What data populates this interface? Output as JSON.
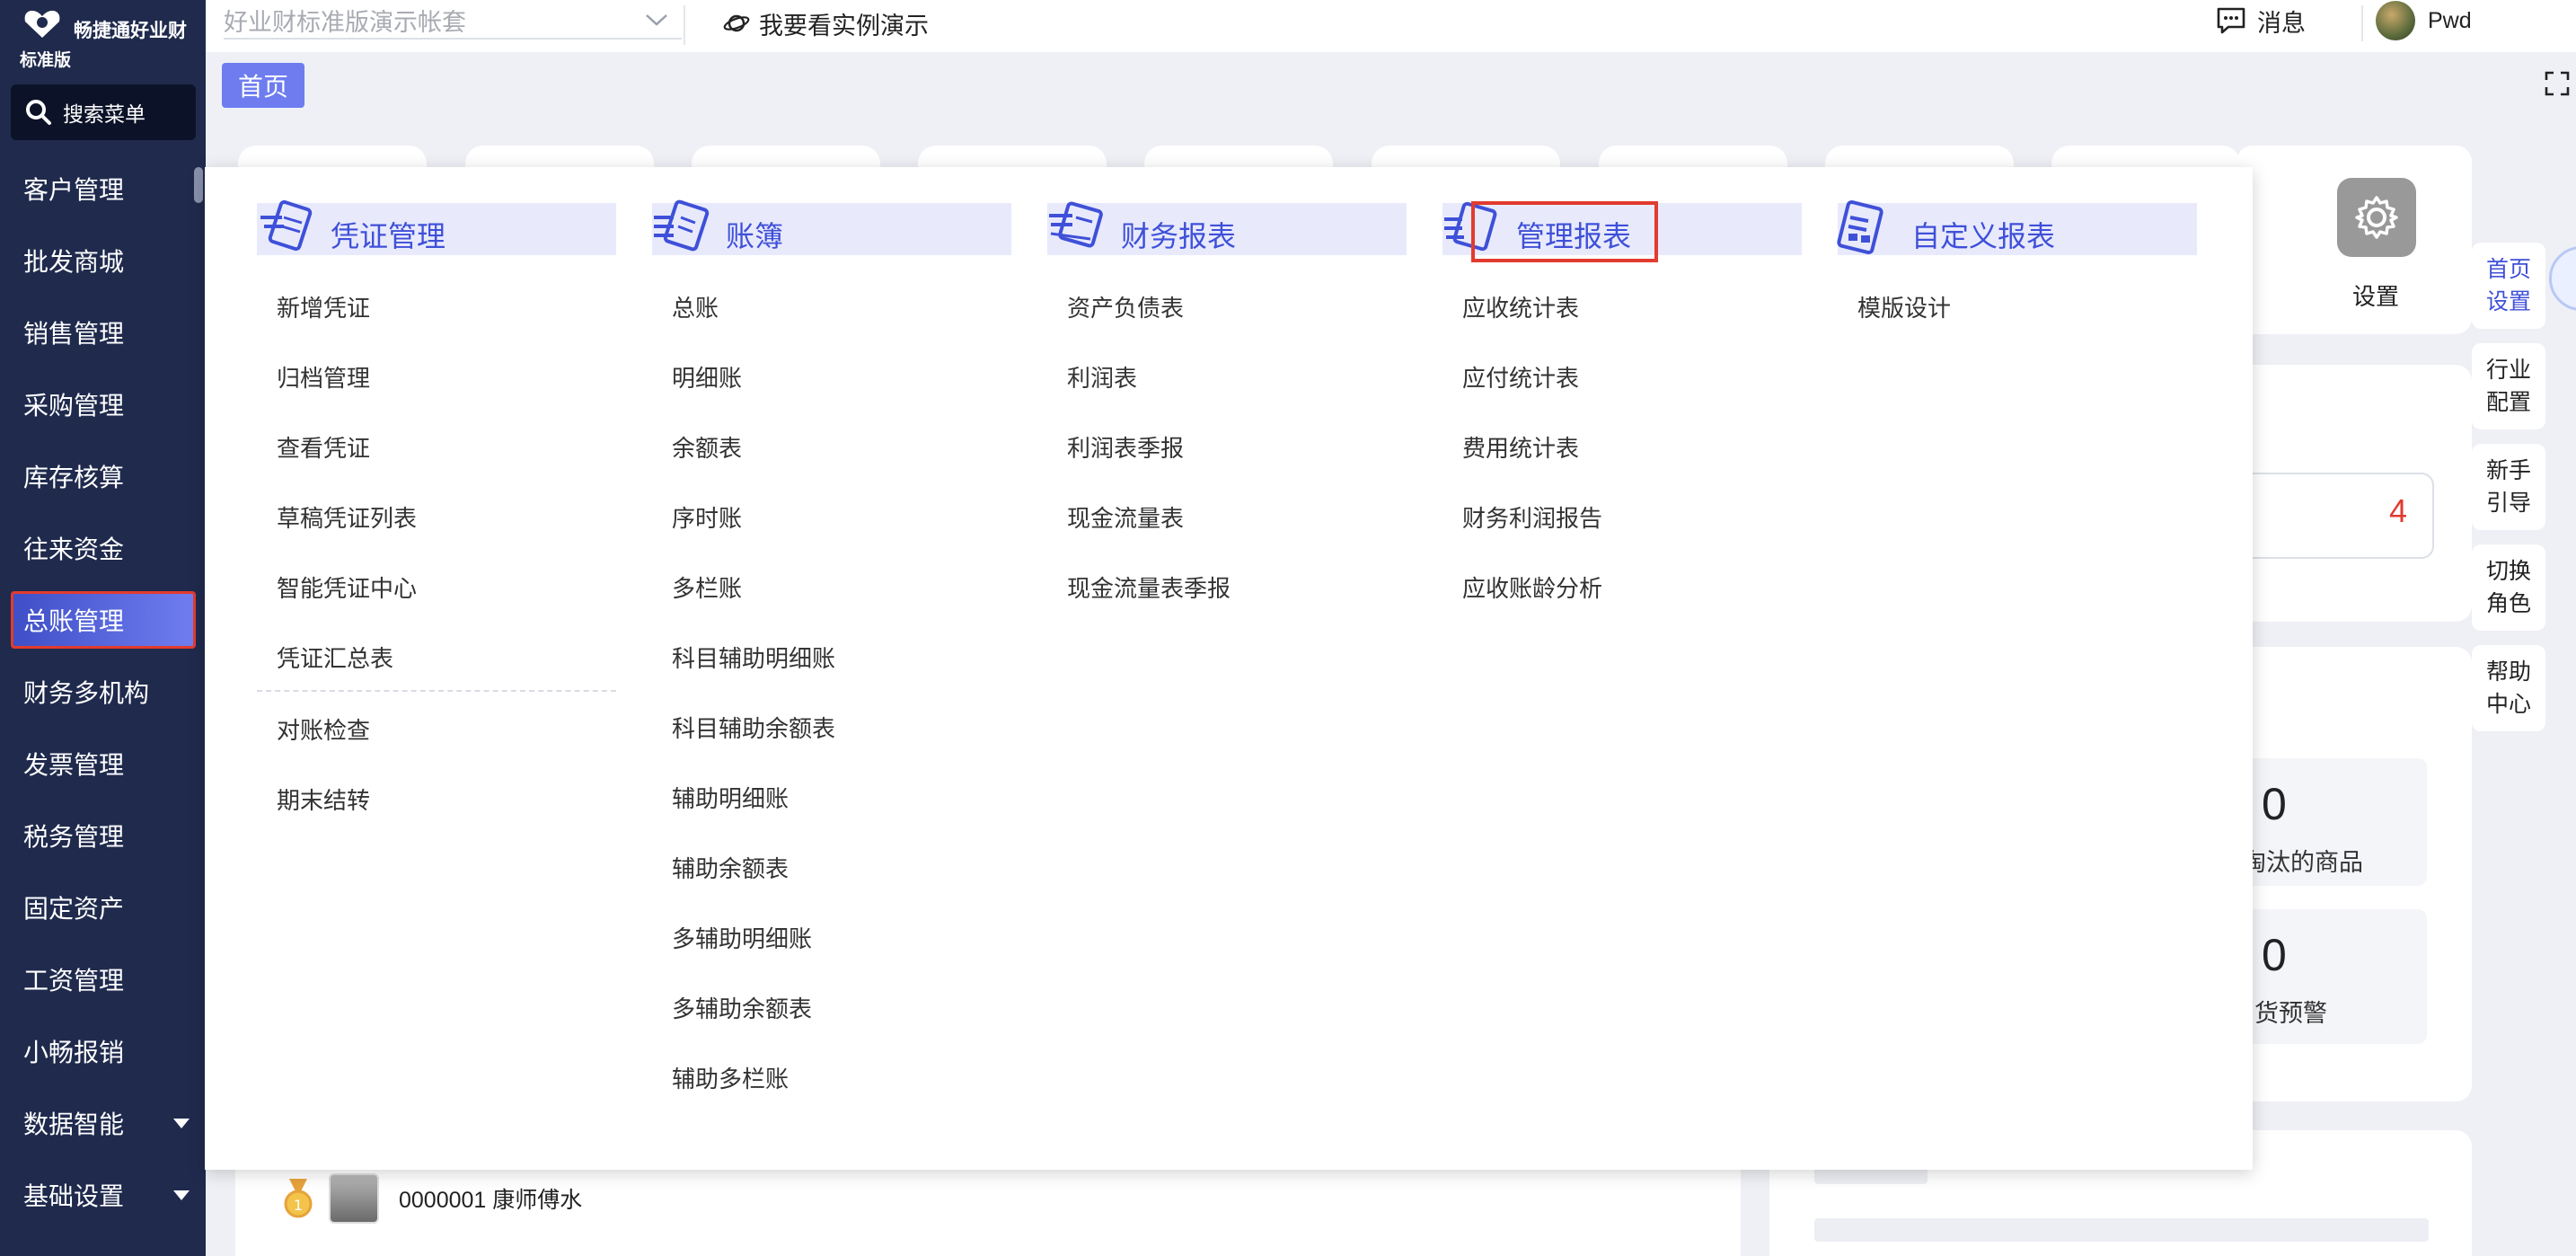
{
  "brand": {
    "name": "畅捷通好业财",
    "edition": "标准版"
  },
  "search_menu": {
    "label": "搜索菜单"
  },
  "sidebar": {
    "items": [
      {
        "label": "客户管理",
        "active": false,
        "expandable": false
      },
      {
        "label": "批发商城",
        "active": false,
        "expandable": false
      },
      {
        "label": "销售管理",
        "active": false,
        "expandable": false
      },
      {
        "label": "采购管理",
        "active": false,
        "expandable": false
      },
      {
        "label": "库存核算",
        "active": false,
        "expandable": false
      },
      {
        "label": "往来资金",
        "active": false,
        "expandable": false
      },
      {
        "label": "总账管理",
        "active": true,
        "expandable": false
      },
      {
        "label": "财务多机构",
        "active": false,
        "expandable": false
      },
      {
        "label": "发票管理",
        "active": false,
        "expandable": false
      },
      {
        "label": "税务管理",
        "active": false,
        "expandable": false
      },
      {
        "label": "固定资产",
        "active": false,
        "expandable": false
      },
      {
        "label": "工资管理",
        "active": false,
        "expandable": false
      },
      {
        "label": "小畅报销",
        "active": false,
        "expandable": false
      },
      {
        "label": "数据智能",
        "active": false,
        "expandable": true
      },
      {
        "label": "基础设置",
        "active": false,
        "expandable": true
      }
    ]
  },
  "topbar": {
    "account_placeholder": "好业财标准版演示帐套",
    "demo_label": "我要看实例演示",
    "messages_label": "消息",
    "user_name": "Pwd"
  },
  "tabs": {
    "home": "首页"
  },
  "menu": {
    "columns": [
      {
        "title": "凭证管理",
        "icon": "voucher-icon",
        "highlighted": false,
        "items": [
          "新增凭证",
          "归档管理",
          "查看凭证",
          "草稿凭证列表",
          "智能凭证中心",
          "凭证汇总表"
        ],
        "items_after_separator": [
          "对账检查",
          "期末结转"
        ]
      },
      {
        "title": "账簿",
        "icon": "ledger-icon",
        "highlighted": false,
        "items": [
          "总账",
          "明细账",
          "余额表",
          "序时账",
          "多栏账",
          "科目辅助明细账",
          "科目辅助余额表",
          "辅助明细账",
          "辅助余额表",
          "多辅助明细账",
          "多辅助余额表",
          "辅助多栏账"
        ],
        "items_after_separator": []
      },
      {
        "title": "财务报表",
        "icon": "financial-report-icon",
        "highlighted": false,
        "items": [
          "资产负债表",
          "利润表",
          "利润表季报",
          "现金流量表",
          "现金流量表季报"
        ],
        "items_after_separator": []
      },
      {
        "title": "管理报表",
        "icon": "management-report-icon",
        "highlighted": true,
        "items": [
          "应收统计表",
          "应付统计表",
          "费用统计表",
          "财务利润报告",
          "应收账龄分析"
        ],
        "items_after_separator": []
      },
      {
        "title": "自定义报表",
        "icon": "custom-report-icon",
        "highlighted": false,
        "items": [
          "模版设计"
        ],
        "items_after_separator": []
      }
    ]
  },
  "settings_card": {
    "label": "设置"
  },
  "right_rail": [
    {
      "label": "首页设置"
    },
    {
      "label": "行业配置"
    },
    {
      "label": "新手引导"
    },
    {
      "label": "切换角色"
    },
    {
      "label": "帮助中心"
    }
  ],
  "stats": {
    "red_value": "4",
    "stat1_value": "0",
    "stat1_label": "淘汰的商品",
    "stat2_value": "0",
    "stat2_label": "货预警"
  },
  "ranking": {
    "rank": "1",
    "item_label": "0000001 康师傅水"
  },
  "colors": {
    "sidebar_bg": "#1f2a4d",
    "accent": "#3f50d8",
    "highlight_border": "#e23b2f",
    "tab_bg": "#6e7cf0"
  }
}
